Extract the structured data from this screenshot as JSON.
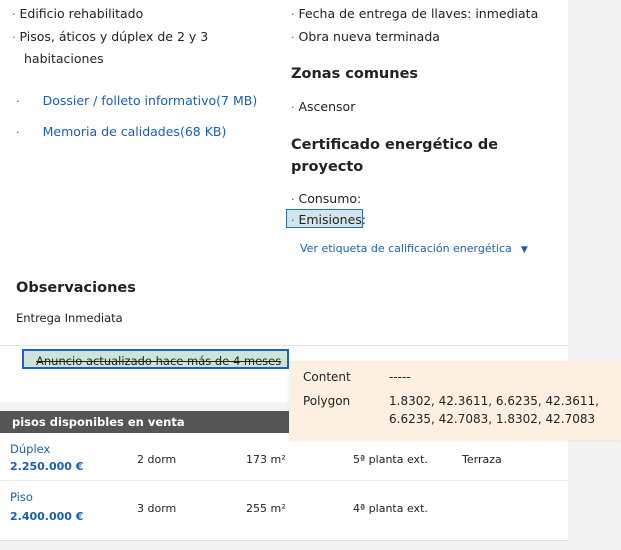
{
  "left_column": {
    "features": [
      "Edificio rehabilitado",
      "Pisos, áticos y dúplex de 2 y 3",
      "habitaciones"
    ],
    "downloads": [
      "Dossier / folleto informativo(7 MB)",
      "Memoria de calidades(68 KB)"
    ]
  },
  "right_column": {
    "features": [
      "Fecha de entrega de llaves: inmediata",
      "Obra nueva terminada"
    ],
    "common_areas_title": "Zonas comunes",
    "common_areas": [
      "Ascensor"
    ],
    "energy_title_line1": "Certificado energético de",
    "energy_title_line2": "proyecto",
    "energy_items": [
      "Consumo:",
      "Emisiones:"
    ],
    "energy_link": "Ver etiqueta de calificación energética",
    "energy_link_icon": "caret-down-icon"
  },
  "observations": {
    "title": "Observaciones",
    "text": "Entrega Inmediata"
  },
  "update_notice": "Anuncio actualizado hace más de 4 meses",
  "units_table": {
    "header": "pisos disponibles en venta",
    "rows": [
      {
        "type": "Dúplex",
        "price": "2.250.000 €",
        "bedrooms": "2 dorm",
        "area": "173 m²",
        "floor": "5ª planta ext.",
        "extra": "Terraza"
      },
      {
        "type": "Piso",
        "price": "2.400.000 €",
        "bedrooms": "3 dorm",
        "area": "255 m²",
        "floor": "4ª planta ext.",
        "extra": ""
      }
    ]
  },
  "tooltip": {
    "content_label": "Content",
    "content_value": "-----",
    "polygon_label": "Polygon",
    "polygon_line1": "1.8302, 42.3611, 6.6235, 42.3611,",
    "polygon_line2": "6.6235, 42.7083, 1.8302, 42.7083"
  },
  "bullet_glyph": "·"
}
